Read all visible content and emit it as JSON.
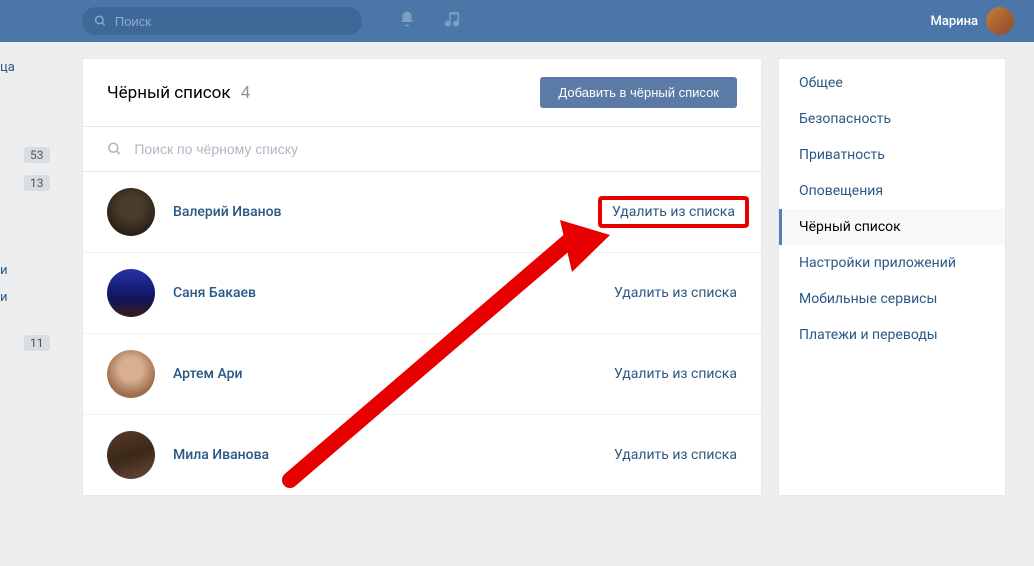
{
  "topbar": {
    "search_placeholder": "Поиск",
    "username": "Марина"
  },
  "left_badges": {
    "text1": "ца",
    "badge1": "53",
    "badge2": "13",
    "text2": "и",
    "text3": "и",
    "badge3": "11"
  },
  "main": {
    "title": "Чёрный список",
    "count": "4",
    "add_button": "Добавить в чёрный список",
    "search_placeholder": "Поиск по чёрному списку",
    "remove_label": "Удалить из списка",
    "items": [
      {
        "name": "Валерий Иванов"
      },
      {
        "name": "Саня Бакаев"
      },
      {
        "name": "Артем Ари"
      },
      {
        "name": "Мила Иванова"
      }
    ]
  },
  "sidebar": {
    "items": [
      "Общее",
      "Безопасность",
      "Приватность",
      "Оповещения",
      "Чёрный список",
      "Настройки приложений",
      "Мобильные сервисы",
      "Платежи и переводы"
    ],
    "active_index": 4
  }
}
